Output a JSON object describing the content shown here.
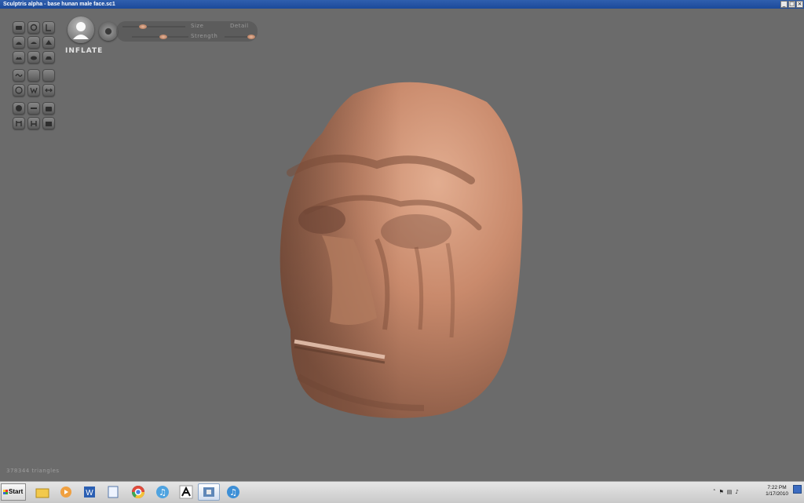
{
  "window": {
    "title": "Sculptris alpha - base hunan male face.sc1",
    "controls": [
      "minimize-icon",
      "restore-icon",
      "close-icon"
    ]
  },
  "tool_groups": [
    {
      "tools": [
        "grab-icon",
        "rotate-icon",
        "scale-icon",
        "draw-icon",
        "flatten-icon",
        "crease-icon",
        "pinch-icon",
        "smooth-icon",
        "reduce-icon"
      ]
    },
    {
      "tools": [
        "wave-icon",
        "blank-icon",
        "blank-icon",
        "brush-icon",
        "symmetry-icon",
        "swap-icon"
      ]
    },
    {
      "tools": [
        "sphere-icon",
        "plane-icon",
        "camera-icon",
        "mask-icon",
        "paint-icon",
        "settings-icon"
      ]
    }
  ],
  "brush": {
    "mode": "INFLATE",
    "size_label": "Size",
    "strength_label": "Strength",
    "detail_label": "Detail",
    "size_value": 0.33,
    "strength_value": 0.55,
    "detail_value": 0.9
  },
  "status": {
    "triangles": "378344 triangles"
  },
  "taskbar": {
    "start_label": "Start",
    "apps": [
      "explorer-icon",
      "media-player-icon",
      "word-icon",
      "notepad-icon",
      "chrome-icon",
      "itunes-icon",
      "gimp-icon",
      "sculptris-icon",
      "itunes-icon"
    ],
    "active_index": 7,
    "clock_time": "7:22 PM",
    "clock_date": "1/17/2010"
  },
  "colors": {
    "viewport": "#6b6b6b",
    "skin": "#c98a6c",
    "titlebar": "#1c4a9a"
  }
}
